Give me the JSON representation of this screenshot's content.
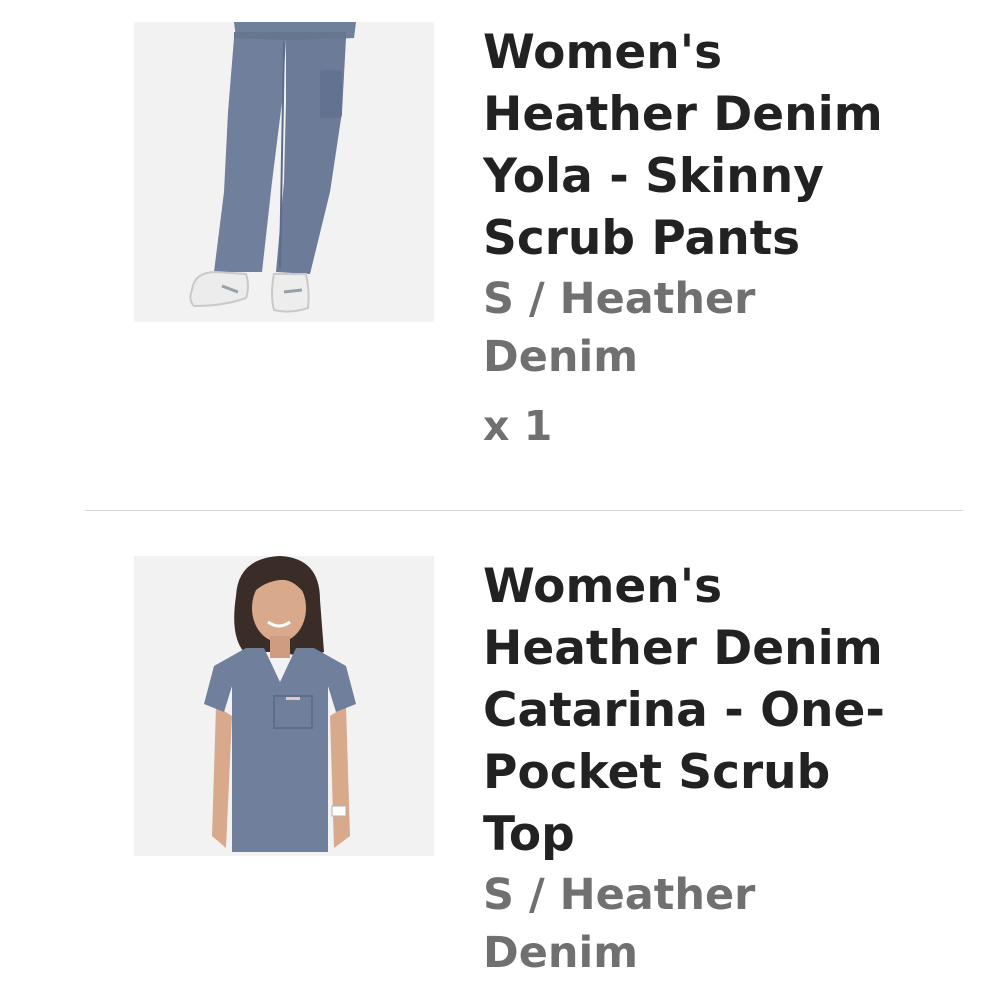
{
  "cart": {
    "items": [
      {
        "title": "Women's Heather Denim Yola - Skinny Scrub Pants",
        "variant": "S / Heather Denim",
        "quantity": "x 1",
        "image_icon": "scrub-pants-photo"
      },
      {
        "title": "Women's Heather Denim Catarina - One-Pocket Scrub Top",
        "variant": "S / Heather Denim",
        "image_icon": "scrub-top-photo"
      }
    ]
  },
  "colors": {
    "title": "#222222",
    "secondary_text": "#707070",
    "thumbnail_bg": "#f2f2f2",
    "denim": "#6f7f9c",
    "divider": "#d4d4d4"
  }
}
